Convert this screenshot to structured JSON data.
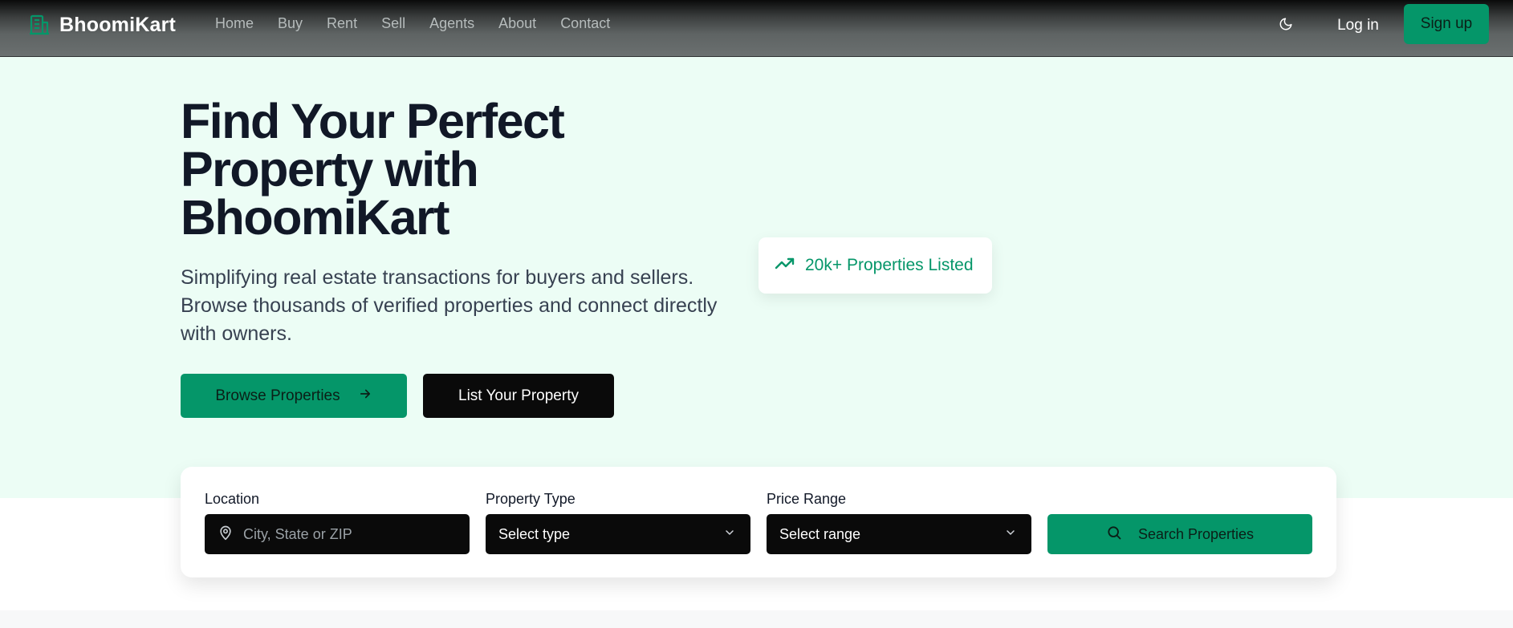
{
  "header": {
    "brand": "BhoomiKart",
    "nav": [
      "Home",
      "Buy",
      "Rent",
      "Sell",
      "Agents",
      "About",
      "Contact"
    ],
    "login_label": "Log in",
    "signup_label": "Sign up"
  },
  "hero": {
    "title": "Find Your Perfect Property with BhoomiKart",
    "subtitle": "Simplifying real estate transactions for buyers and sellers. Browse thousands of verified properties and connect directly with owners.",
    "browse_label": "Browse Properties",
    "list_label": "List Your Property",
    "stat_label": "20k+ Properties Listed"
  },
  "search": {
    "location_label": "Location",
    "location_placeholder": "City, State or ZIP",
    "type_label": "Property Type",
    "type_value": "Select type",
    "price_label": "Price Range",
    "price_value": "Select range",
    "search_label": "Search Properties"
  },
  "colors": {
    "accent": "#059669",
    "hero_bg": "#ecfdf5",
    "dark": "#0a0a0a",
    "heading": "#111827"
  },
  "icons": {
    "brand": "building-icon",
    "theme": "moon-icon",
    "browse": "arrow-right-icon",
    "stat": "trending-up-icon",
    "location": "map-pin-icon",
    "dropdown": "chevron-down-icon",
    "search": "search-icon"
  }
}
